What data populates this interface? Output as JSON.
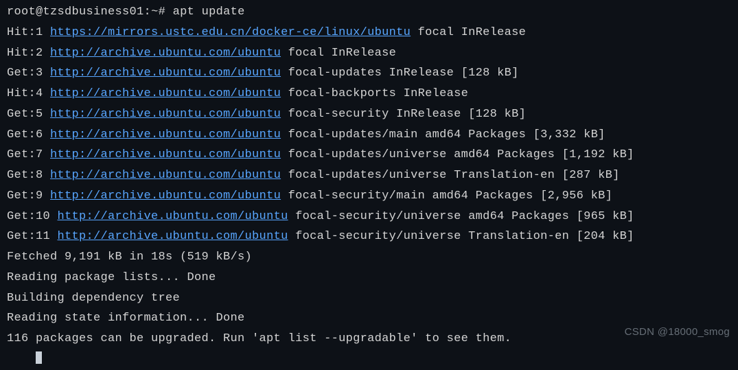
{
  "prompt": {
    "user_host": "root@tzsdbusiness01",
    "path": "~",
    "symbol": "#",
    "command": "apt update"
  },
  "lines": [
    {
      "prefix": "Hit:1 ",
      "url": "https://mirrors.ustc.edu.cn/docker-ce/linux/ubuntu",
      "suffix": " focal InRelease"
    },
    {
      "prefix": "Hit:2 ",
      "url": "http://archive.ubuntu.com/ubuntu",
      "suffix": " focal InRelease"
    },
    {
      "prefix": "Get:3 ",
      "url": "http://archive.ubuntu.com/ubuntu",
      "suffix": " focal-updates InRelease [128 kB]"
    },
    {
      "prefix": "Hit:4 ",
      "url": "http://archive.ubuntu.com/ubuntu",
      "suffix": " focal-backports InRelease"
    },
    {
      "prefix": "Get:5 ",
      "url": "http://archive.ubuntu.com/ubuntu",
      "suffix": " focal-security InRelease [128 kB]"
    },
    {
      "prefix": "Get:6 ",
      "url": "http://archive.ubuntu.com/ubuntu",
      "suffix": " focal-updates/main amd64 Packages [3,332 kB]"
    },
    {
      "prefix": "Get:7 ",
      "url": "http://archive.ubuntu.com/ubuntu",
      "suffix": " focal-updates/universe amd64 Packages [1,192 kB]"
    },
    {
      "prefix": "Get:8 ",
      "url": "http://archive.ubuntu.com/ubuntu",
      "suffix": " focal-updates/universe Translation-en [287 kB]"
    },
    {
      "prefix": "Get:9 ",
      "url": "http://archive.ubuntu.com/ubuntu",
      "suffix": " focal-security/main amd64 Packages [2,956 kB]"
    },
    {
      "prefix": "Get:10 ",
      "url": "http://archive.ubuntu.com/ubuntu",
      "suffix": " focal-security/universe amd64 Packages [965 kB]"
    },
    {
      "prefix": "Get:11 ",
      "url": "http://archive.ubuntu.com/ubuntu",
      "suffix": " focal-security/universe Translation-en [204 kB]"
    }
  ],
  "summary": [
    "Fetched 9,191 kB in 18s (519 kB/s)",
    "Reading package lists... Done",
    "Building dependency tree",
    "Reading state information... Done",
    "116 packages can be upgraded. Run 'apt list --upgradable' to see them."
  ],
  "prompt2_partial": "    ",
  "watermark": "CSDN @18000_smog"
}
